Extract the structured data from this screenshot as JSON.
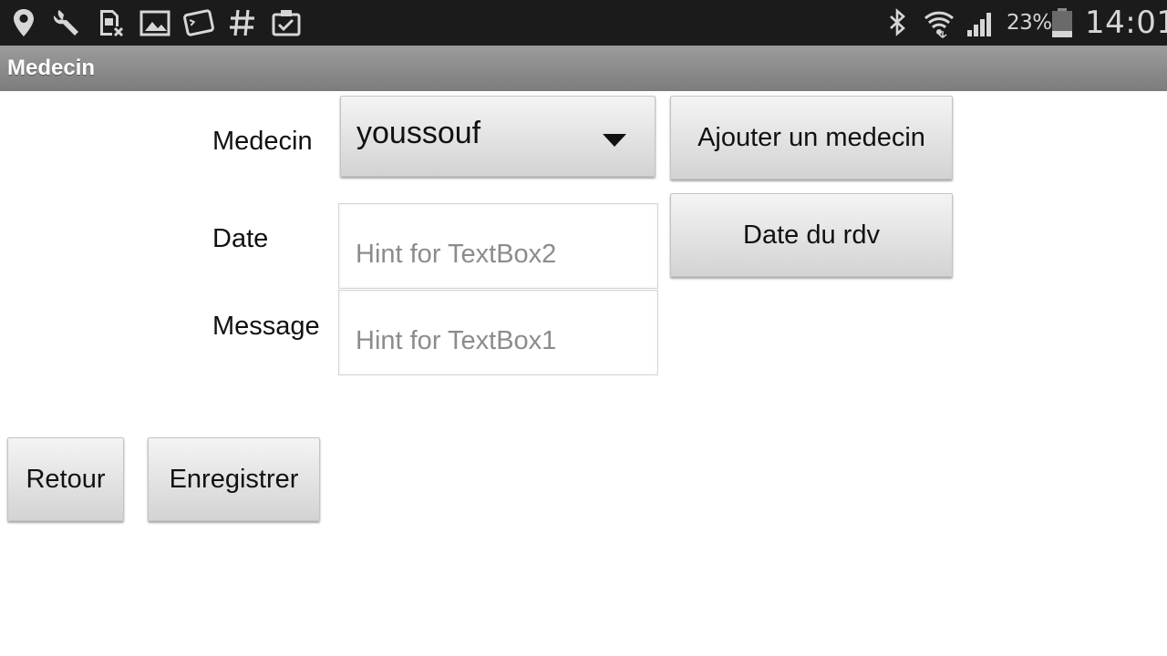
{
  "status_bar": {
    "icons_left": [
      "location-icon",
      "wrench-icon",
      "sim-blocked-icon",
      "image-icon",
      "terminal-icon",
      "hash-icon",
      "clipboard-check-icon"
    ],
    "icons_right": [
      "bluetooth-icon",
      "wifi-icon",
      "signal-icon",
      "battery-icon"
    ],
    "battery_percent": "23%",
    "battery_level": 0.23,
    "time": "14:01"
  },
  "app": {
    "title": "Medecin"
  },
  "form": {
    "medecin_label": "Medecin",
    "medecin_selected": "youssouf",
    "add_medecin_button": "Ajouter un medecin",
    "date_label": "Date",
    "date_placeholder": "Hint for TextBox2",
    "date_button": "Date du rdv",
    "message_label": "Message",
    "message_placeholder": "Hint for TextBox1"
  },
  "actions": {
    "back_button": "Retour",
    "save_button": "Enregistrer"
  }
}
